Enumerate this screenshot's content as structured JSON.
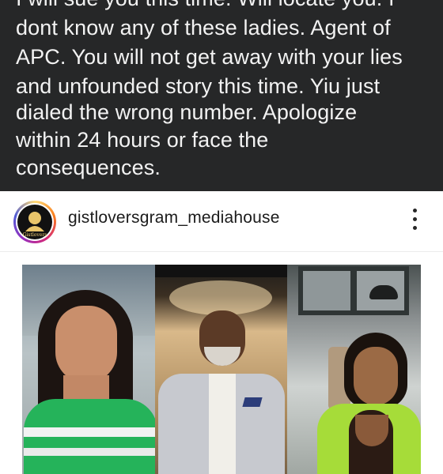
{
  "caption": {
    "lines": [
      "I will sue you this time. Will locate you. I",
      "dont know any of these ladies. Agent of",
      "APC. You will not get away with your lies",
      "and unfounded story this time. Yiu just",
      "dialed the wrong number. Apologize",
      "within 24 hours or face the",
      "consequences."
    ]
  },
  "post": {
    "username": "gistloversgram_mediahouse",
    "avatar_text": "Gistlovers"
  },
  "icons": {
    "more": "more-vertical-icon"
  }
}
